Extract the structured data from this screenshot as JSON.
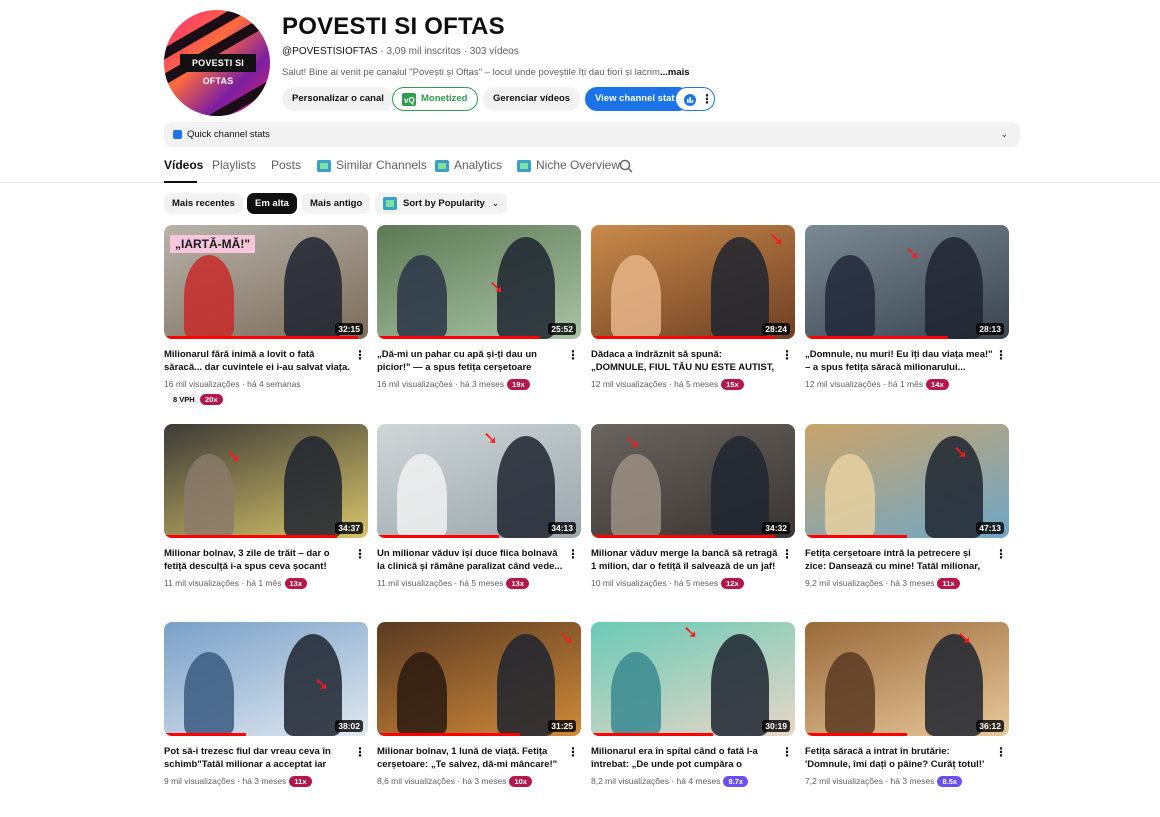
{
  "channel": {
    "name": "POVESTI SI OFTAS",
    "logo_text": "POVESTI SI OFTAS",
    "handle": "@POVESTISIOFTAS",
    "subscribers": "3,09 mil inscritos",
    "videos_count": "303 vídeos",
    "description": "Salut! Bine ai venit pe canalul \"Povești și Oftas\" – locul unde poveștile îți dau fiori și lacrim",
    "more_label": "...mais"
  },
  "actions": {
    "customize": "Personalizar o canal",
    "monetized": "Monetized",
    "manage": "Gerenciar vídeos",
    "view_stats": "View channel stats"
  },
  "quick_stats": {
    "label": "Quick channel stats"
  },
  "tabs": [
    "Vídeos",
    "Playlists",
    "Posts",
    "Similar Channels",
    "Analytics",
    "Niche Overview"
  ],
  "filters": {
    "recent": "Mais recentes",
    "popular": "Em alta",
    "oldest": "Mais antigo",
    "sort": "Sort by Popularity"
  },
  "colors": {
    "accent_blue": "#1a73e8",
    "monetized_green": "#2e9d4f",
    "badge_red": "#b5174a",
    "badge_purple": "#6a4ff5",
    "progress_red": "#ff0000"
  },
  "videos": [
    {
      "title": "Milionarul fără inimă a lovit o fată săracă... dar cuvintele ei i-au salvat viața.",
      "duration": "32:15",
      "views": "16 mil visualizações",
      "age": "há 4 semanas",
      "vph": "8 VPH",
      "outlier": "20x",
      "overlay": "„IARTĂ-MĂ!\""
    },
    {
      "title": "„Dă-mi un pahar cu apă și-ți dau un picior!\" — a spus fetița cerșetoare milionarului...",
      "duration": "25:52",
      "views": "16 mil visualizações",
      "age": "há 3 meses",
      "outlier": "19x"
    },
    {
      "title": "Dădaca a îndrăznit să spună: „DOMNULE, FIUL TĂU NU ESTE AUTIST, ARE NEVOIE...",
      "duration": "28:24",
      "views": "12 mil visualizações",
      "age": "há 5 meses",
      "outlier": "15x"
    },
    {
      "title": "„Domnule, nu muri! Eu îți dau viața mea!\" – a spus fetița săracă milionarului...",
      "duration": "28:13",
      "views": "12 mil visualizações",
      "age": "há 1 mês",
      "outlier": "14x"
    },
    {
      "title": "Milionar bolnav, 3 zile de trăit – dar o fetiță desculță i-a spus ceva șocant!",
      "duration": "34:37",
      "views": "11 mil visualizações",
      "age": "há 1 mês",
      "outlier": "13x"
    },
    {
      "title": "Un milionar văduv își duce fiica bolnavă la clinică și rămâne paralizat când vede...",
      "duration": "34:13",
      "views": "11 mil visualizações",
      "age": "há 5 meses",
      "outlier": "13x"
    },
    {
      "title": "Milionar văduv merge la bancă să retragă 1 milion, dar o fetiță îl salvează de un jaf!",
      "duration": "34:32",
      "views": "10 mil visualizações",
      "age": "há 5 meses",
      "outlier": "12x"
    },
    {
      "title": "Fetița cerșetoare intră la petrecere și zice: Dansează cu mine! Tatăl milionar, șocat!\"",
      "duration": "47:13",
      "views": "9,2 mil visualizações",
      "age": "há 3 meses",
      "outlier": "11x"
    },
    {
      "title": "Pot să-i trezesc fiul dar vreau ceva în schimb\"Tatăl milionar a acceptat iar cerere...",
      "duration": "38:02",
      "views": "9 mil visualizações",
      "age": "há 3 meses",
      "outlier": "11x"
    },
    {
      "title": "Milionar bolnav, 1 lună de viață. Fetița cerșetoare: „Te salvez, dă-mi mâncare!\"",
      "duration": "31:25",
      "views": "8,6 mil visualizações",
      "age": "há 3 meses",
      "outlier": "10x"
    },
    {
      "title": "Milionarul era în spital când o fată l-a întrebat: „De unde pot cumpăra o inimă...?\"",
      "duration": "30:19",
      "views": "8,2 mil visualizações",
      "age": "há 4 meses",
      "outlier": "9.7x"
    },
    {
      "title": "Fetița săracă a intrat în brutărie: 'Domnule, îmi dați o pâine? Curăț totul!' El era miliarda...",
      "duration": "36:12",
      "views": "7,2 mil visualizações",
      "age": "há 3 meses",
      "outlier": "8.5x"
    }
  ]
}
